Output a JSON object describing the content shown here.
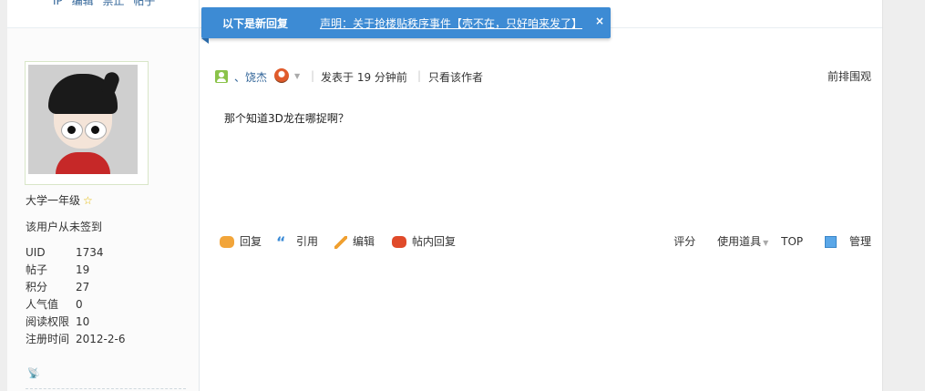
{
  "top_links": [
    "IP",
    "编辑",
    "禁止",
    "帖子"
  ],
  "notice": {
    "title": "以下是新回复",
    "link": "声明：关于抢楼贴秩序事件【壳不在，只好咱来发了】",
    "close": "×"
  },
  "profile": {
    "rank": "大学一年级",
    "signin": "该用户从未签到",
    "stats": [
      {
        "label": "UID",
        "value": "1734"
      },
      {
        "label": "帖子",
        "value": "19"
      },
      {
        "label": "积分",
        "value": "27"
      },
      {
        "label": "人气值",
        "value": "0"
      },
      {
        "label": "阅读权限",
        "value": "10"
      },
      {
        "label": "注册时间",
        "value": "2012-2-6"
      }
    ]
  },
  "post": {
    "author": "、饶杰",
    "time_text": "发表于 19 分钟前",
    "only_author": "只看该作者",
    "floor": "前排围观",
    "message": "那个知道3D龙在哪捉啊？"
  },
  "actions": {
    "reply": "回复",
    "quote": "引用",
    "edit": "编辑",
    "inner_reply": "帖内回复",
    "rate": "评分",
    "use_tool": "使用道具",
    "top": "TOP",
    "manage": "管理"
  },
  "colors": {
    "notice_bg": "#3d8bd4",
    "link": "#336699"
  }
}
